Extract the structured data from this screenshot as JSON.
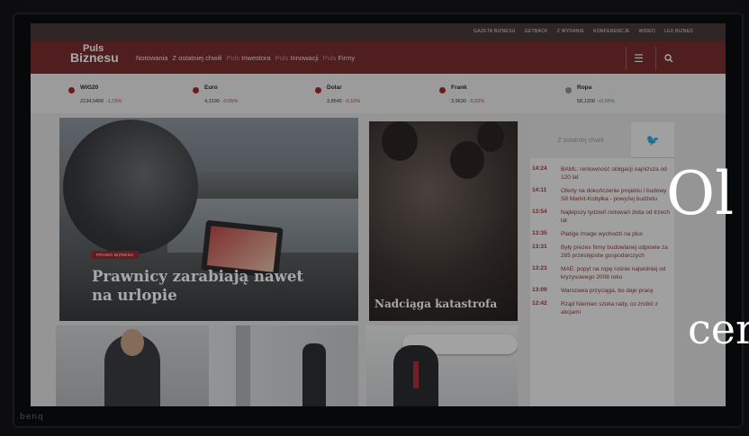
{
  "monitor": {
    "brand": "benq"
  },
  "top_links": [
    "GAZETA BIZNESU",
    "GETBACK",
    "Z WYDANIE",
    "KONFERENCJE",
    "WIDEO",
    "LEX BIZNES"
  ],
  "logo": {
    "line1": "Puls",
    "line2": "Biznesu"
  },
  "menu": [
    {
      "label": "Notowania",
      "dim": false
    },
    {
      "label": "Z ostatniej chwili",
      "dim": false
    },
    {
      "label": "Puls",
      "dim": true
    },
    {
      "label": "Inwestora",
      "dim": false
    },
    {
      "label": "Puls",
      "dim": true
    },
    {
      "label": "Innowacji",
      "dim": false
    },
    {
      "label": "Puls",
      "dim": true
    },
    {
      "label": "Firmy",
      "dim": false
    }
  ],
  "icons": {
    "menu": "hamburger-icon",
    "search": "search-icon",
    "twitter": "twitter-icon"
  },
  "tickers": [
    {
      "name": "WIG20",
      "value": "2134,0400",
      "change": "-1,15%",
      "up": false
    },
    {
      "name": "Euro",
      "value": "4,3190",
      "change": "-0,05%",
      "up": false
    },
    {
      "name": "Dolar",
      "value": "3,8545",
      "change": "-0,10%",
      "up": false
    },
    {
      "name": "Frank",
      "value": "3,9630",
      "change": "-0,02%",
      "up": false
    },
    {
      "name": "Ropa",
      "value": "58,1200",
      "change": "+0,65%",
      "up": true
    }
  ],
  "colors": {
    "brand": "#7a2e2e",
    "accent": "#a1262b"
  },
  "cards": {
    "main": {
      "badge": "PRAWO BIZNESU",
      "title": "Prawnicy zarabiają nawet na urlopie"
    },
    "second": {
      "title": "Nadciąga katastrofa"
    }
  },
  "sidebar": {
    "tab_latest": "Z ostatniej chwili",
    "news": [
      {
        "time": "14:24",
        "text": "BAML: rentowność obligacji najniższa od 120 lat"
      },
      {
        "time": "14:11",
        "text": "Oferty na dokończenie projektu i budowy S8 Markit-Kobyłka - powyżej budżetu"
      },
      {
        "time": "13:54",
        "text": "Najlepszy tydzień notowań złota od trzech lat"
      },
      {
        "time": "13:35",
        "text": "Platige Image wychodzi na plus"
      },
      {
        "time": "13:31",
        "text": "Były prezes firmy budowlanej odpowie za 285 przestępstw gospodarczych"
      },
      {
        "time": "13:23",
        "text": "MAE: popyt na ropę rośnie najwolniej od kryzysowego 2008 roku"
      },
      {
        "time": "13:09",
        "text": "Warszawa przyciąga, bo daje pracę"
      },
      {
        "time": "12:42",
        "text": "Rząd Niemiec szuka rady, co zrobić z akcjami"
      }
    ]
  },
  "overlay": {
    "line1": "Ol",
    "line2": "cer"
  }
}
